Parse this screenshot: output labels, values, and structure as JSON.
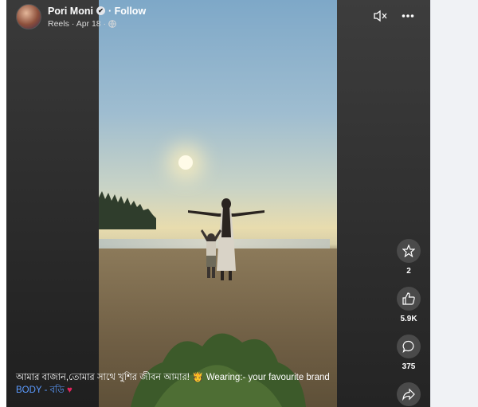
{
  "post": {
    "author": "Pori Moni",
    "verified_mark": "✔",
    "follow_label": "· Follow",
    "source": "Reels",
    "date": "· Apr 18 ·",
    "caption_text": "আমার বাজান,তোমার সাথে খুশির জীবন আমার! 🫅 Wearing:- your favourite brand",
    "tag_text": "BODY - বডি",
    "heart": "♥"
  },
  "actions": {
    "shares_count": "2",
    "likes_count": "5.9K",
    "comments_count": "375"
  },
  "icons": {
    "mute": "speaker-muted-icon",
    "more": "more-options-icon",
    "share_star": "star-share-icon",
    "like": "thumbs-up-icon",
    "comment": "comment-icon",
    "share": "share-arrow-icon"
  },
  "colors": {
    "tag": "#5b9bff",
    "heart": "#e0245e"
  }
}
